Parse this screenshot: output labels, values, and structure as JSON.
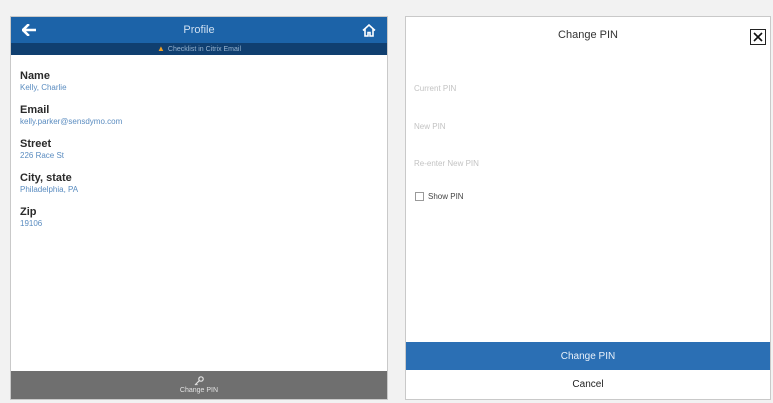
{
  "profile": {
    "title": "Profile",
    "change_notice": "Checklist in Citrix Email",
    "fields": [
      {
        "label": "Name",
        "value": "Kelly, Charlie"
      },
      {
        "label": "Email",
        "value": "kelly.parker@sensdymo.com"
      },
      {
        "label": "Street",
        "value": "226 Race St"
      },
      {
        "label": "City, state",
        "value": "Philadelphia, PA"
      },
      {
        "label": "Zip",
        "value": "19106"
      }
    ],
    "footer_label": "Change PIN"
  },
  "change_pin": {
    "title": "Change PIN",
    "current_pin_placeholder": "Current PIN",
    "new_pin_placeholder": "New PIN",
    "reenter_pin_placeholder": "Re-enter New PIN",
    "show_pin_label": "Show PIN",
    "submit_label": "Change PIN",
    "cancel_label": "Cancel"
  },
  "colors": {
    "header_blue": "#1c63a8",
    "notice_bar": "#103f70",
    "warning": "#f0a026",
    "primary_button": "#2b6fb4",
    "footer_gray": "#6f6f6f"
  },
  "icons": {
    "back": "arrow-left-icon",
    "home": "home-icon",
    "warning": "warning-icon",
    "key": "key-icon",
    "close": "close-icon"
  }
}
